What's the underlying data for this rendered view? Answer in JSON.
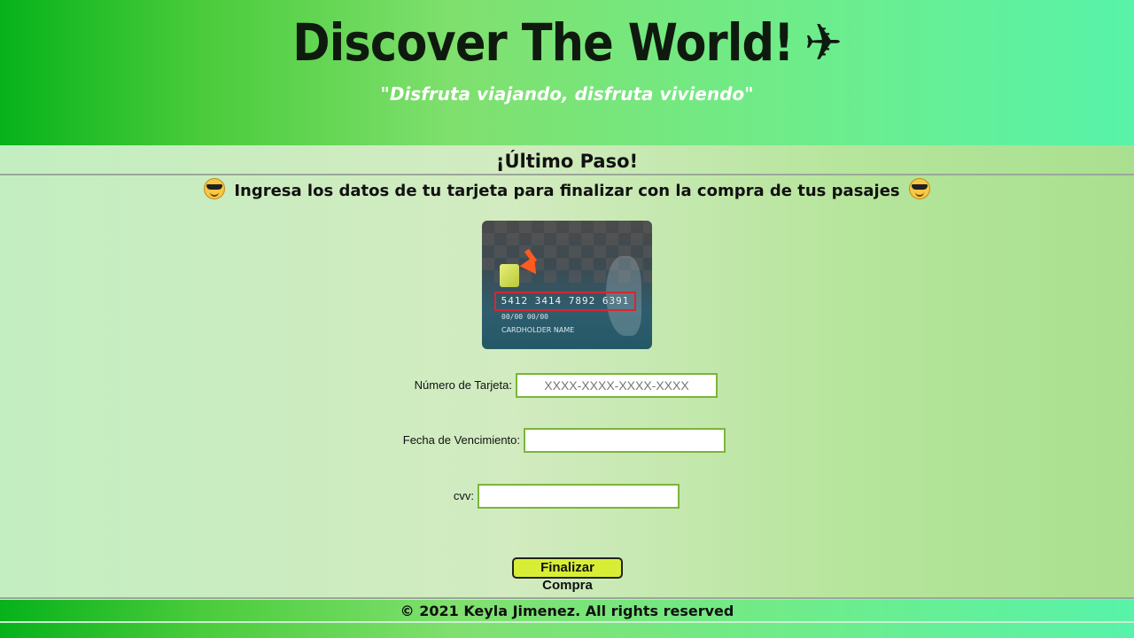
{
  "header": {
    "title": "Discover The World!",
    "plane_icon": "✈",
    "tagline": "\"Disfruta viajando, disfruta viviendo\""
  },
  "main": {
    "step_title": "¡Último Paso!",
    "instruction": "Ingresa los datos de tu tarjeta para finalizar con la compra de tus pasajes",
    "card_image": {
      "number": "5412 3414 7892 6391",
      "dates": "00/00  00/00",
      "holder": "CARDHOLDER NAME"
    },
    "form": {
      "card_number_label": "Número de Tarjeta:",
      "card_number_placeholder": "XXXX-XXXX-XXXX-XXXX",
      "card_number_value": "",
      "expiry_label": "Fecha de Vencimiento:",
      "expiry_value": "",
      "cvv_label": "cvv:",
      "cvv_value": "",
      "submit_label": "Finalizar Compra"
    }
  },
  "footer": {
    "copyright": "© 2021 Keyla Jimenez. All rights reserved"
  },
  "colors": {
    "header_gradient_start": "#06b21a",
    "header_gradient_end": "#57f3a9",
    "submit_button": "#d8ee36",
    "input_border": "#7bb53a"
  }
}
